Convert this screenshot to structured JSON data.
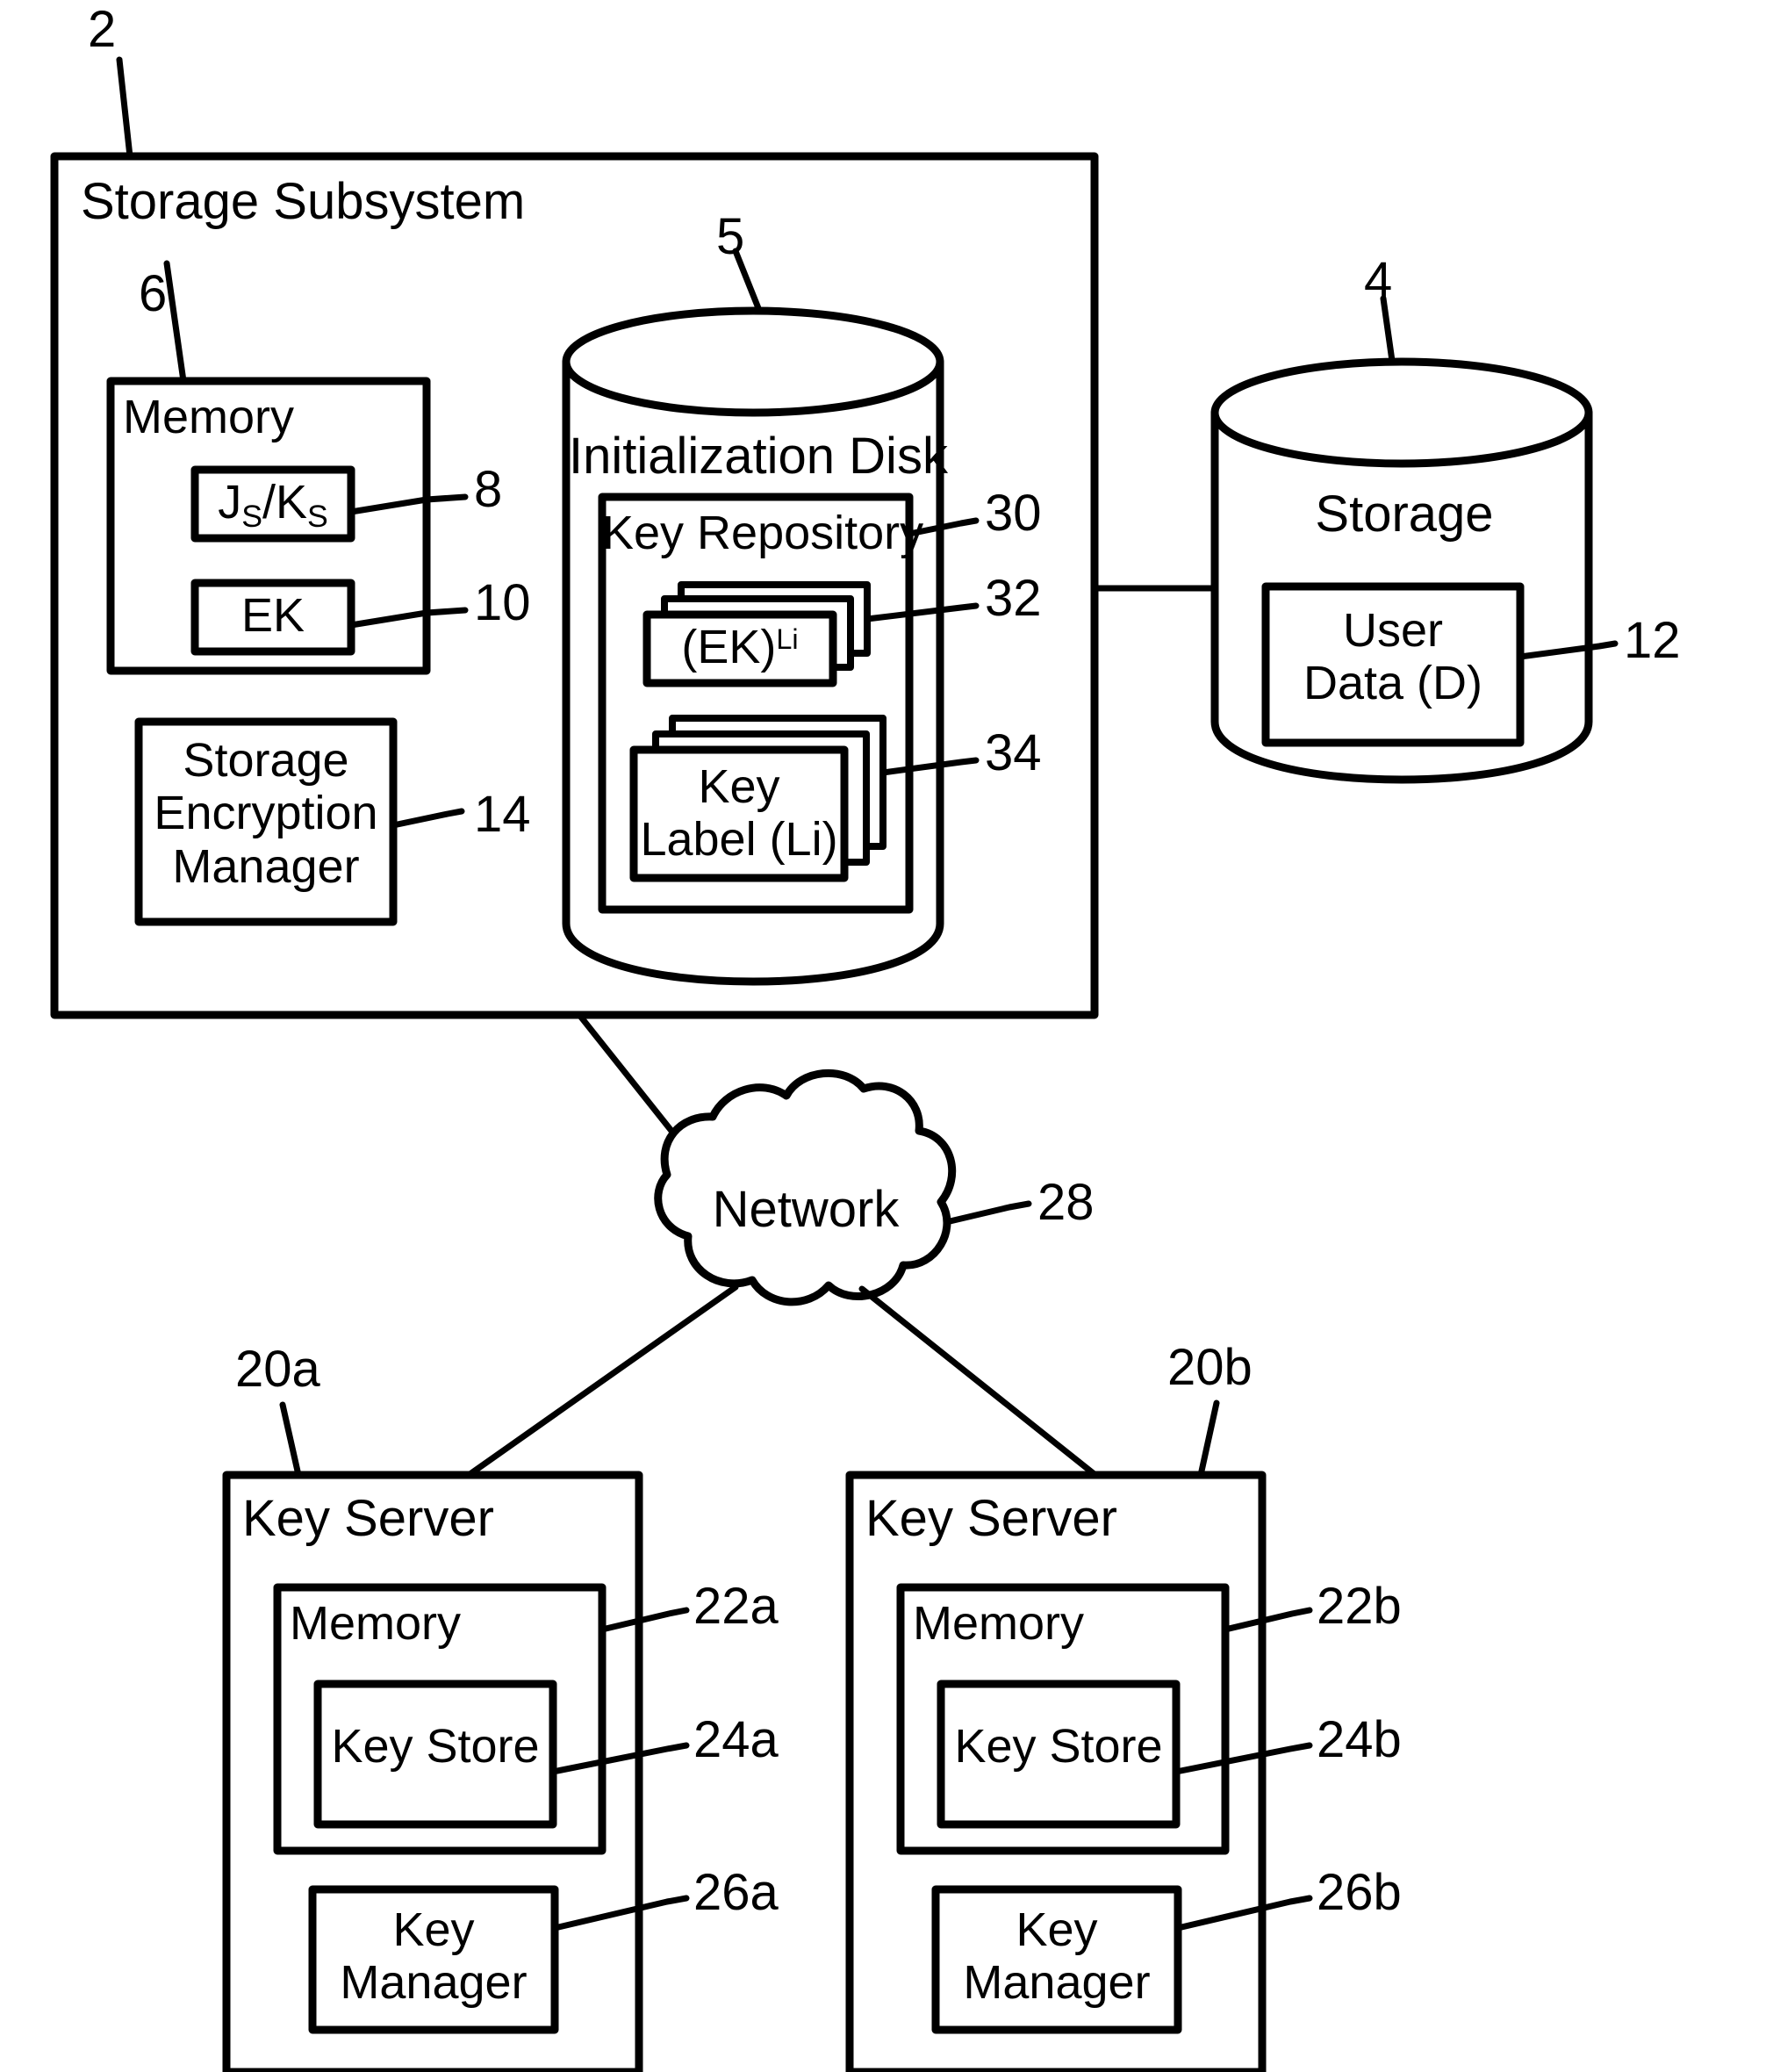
{
  "figure": {
    "type": "patent-block-diagram",
    "title": "Storage subsystem with key servers",
    "background": "#ffffff",
    "stroke": "#000000"
  },
  "storage_subsystem": {
    "ref": "2",
    "label": "Storage Subsystem",
    "memory": {
      "ref": "6",
      "label": "Memory",
      "items": [
        {
          "ref": "8",
          "label_html": "J<sub>S</sub>/K<sub>S</sub>",
          "label_text": "JS/KS"
        },
        {
          "ref": "10",
          "label_html": "EK",
          "label_text": "EK"
        }
      ]
    },
    "storage_encryption_manager": {
      "ref": "14",
      "lines": [
        "Storage",
        "Encryption",
        "Manager"
      ]
    },
    "initialization_disk": {
      "ref": "5",
      "label": "Initialization Disk",
      "key_repository": {
        "ref": "30",
        "label": "Key Repository",
        "stacks": [
          {
            "ref": "32",
            "label_html": "(EK)<sup>Li</sup>",
            "label_text": "(EK)Li",
            "lines": 1,
            "copies": 3
          },
          {
            "ref": "34",
            "label_html": "Key<br>Label (Li)",
            "label_text": "Key Label (Li)",
            "lines": 2,
            "copies": 3
          }
        ]
      }
    }
  },
  "storage": {
    "ref": "4",
    "label": "Storage",
    "user_data": {
      "ref": "12",
      "lines": [
        "User",
        "Data (D)"
      ]
    }
  },
  "network": {
    "ref": "28",
    "label": "Network"
  },
  "key_servers": [
    {
      "ref": "20a",
      "label": "Key Server",
      "memory": {
        "ref": "22a",
        "label": "Memory"
      },
      "key_store": {
        "ref": "24a",
        "label": "Key Store"
      },
      "key_manager": {
        "ref": "26a",
        "lines": [
          "Key",
          "Manager"
        ]
      }
    },
    {
      "ref": "20b",
      "label": "Key Server",
      "memory": {
        "ref": "22b",
        "label": "Memory"
      },
      "key_store": {
        "ref": "24b",
        "label": "Key Store"
      },
      "key_manager": {
        "ref": "26b",
        "lines": [
          "Key",
          "Manager"
        ]
      }
    }
  ]
}
